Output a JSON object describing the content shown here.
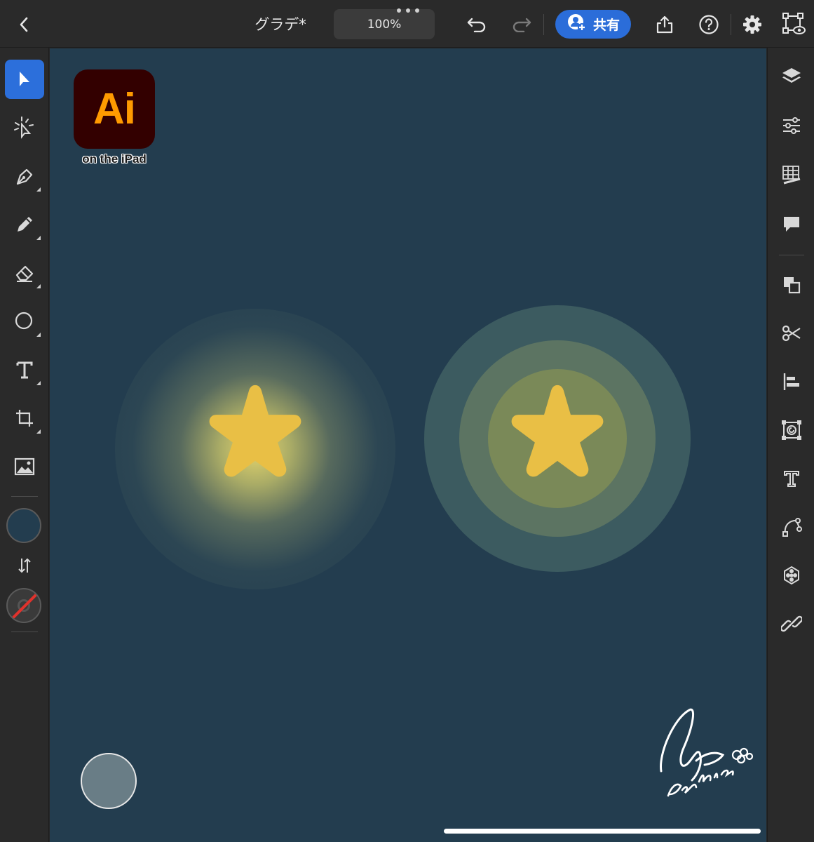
{
  "header": {
    "doc_title": "グラデ*",
    "zoom": "100%",
    "share_label": "共有"
  },
  "canvas": {
    "background_color": "#233d4f",
    "logo": {
      "text": "Ai",
      "caption": "on the iPad"
    },
    "star_color": "#e9bf45",
    "signature": "asahina"
  },
  "left_toolbar": {
    "tools": [
      "selection-tool",
      "direct-selection-tool",
      "pen-tool",
      "pencil-tool",
      "eraser-tool",
      "ellipse-tool",
      "type-tool",
      "transform-tool",
      "image-tool"
    ],
    "fill_color": "#233d4f",
    "stroke": "none"
  },
  "right_panel": {
    "tools": [
      "layers",
      "properties",
      "swatches-grid",
      "comments",
      "arrange",
      "cut",
      "align",
      "repeat",
      "type-settings",
      "path",
      "quick-actions",
      "links"
    ]
  },
  "colors": {
    "accent": "#2c6fdb",
    "share": "#2b6dd9"
  }
}
